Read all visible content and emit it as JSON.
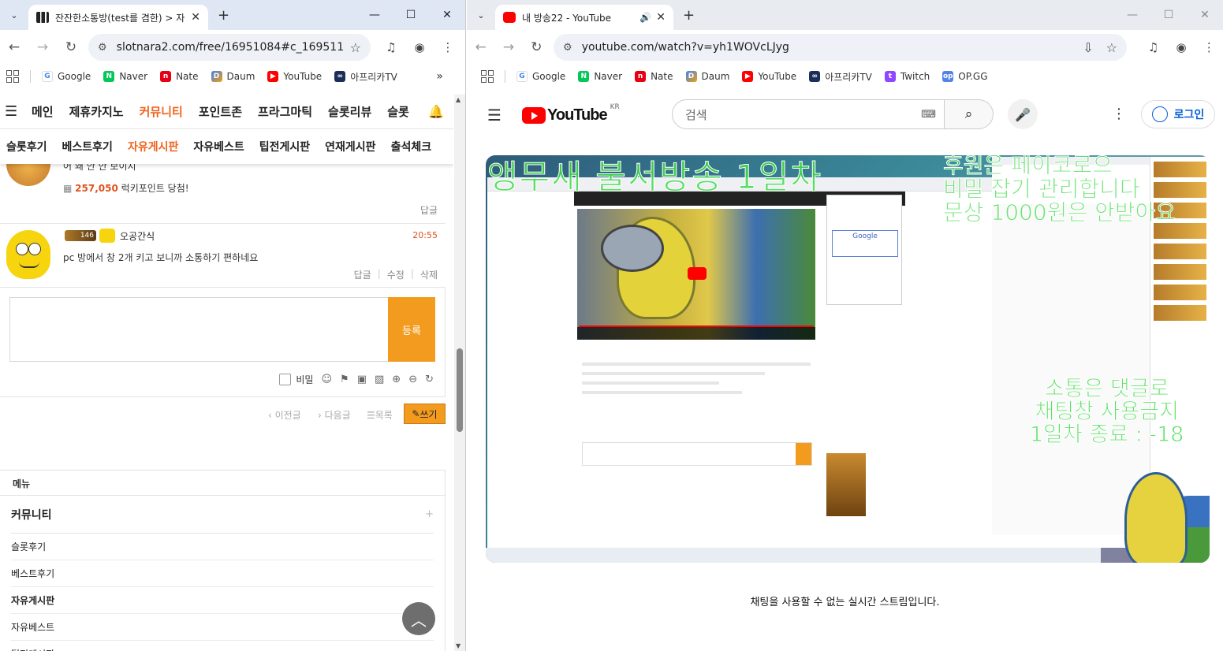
{
  "left": {
    "tab": {
      "title": "잔잔한소통방(test를 겸한) > 자"
    },
    "url": "slotnara2.com/free/16951084#c_16951133",
    "bookmarks": [
      "Google",
      "Naver",
      "Nate",
      "Daum",
      "YouTube",
      "아프리카TV"
    ],
    "gnb": [
      "메인",
      "제휴카지노",
      "커뮤니티",
      "포인트존",
      "프라그마틱",
      "슬롯리뷰",
      "슬롯"
    ],
    "subnav": [
      "슬롯후기",
      "베스트후기",
      "자유게시판",
      "자유베스트",
      "팁전게시판",
      "연재게시판",
      "출석체크"
    ],
    "comment1": {
      "clip": "어 왜 안 안 보이지",
      "points": "257,050",
      "lucky_suffix": "럭키포인트 당첨!",
      "reply": "답글"
    },
    "comment2": {
      "level": "146",
      "nick": "오공간식",
      "time": "20:55",
      "body": "pc 방에서 창 2개 키고 보니까 소통하기 편하네요",
      "reply": "답글",
      "edit": "수정",
      "delete": "삭제"
    },
    "write": {
      "submit": "등록",
      "secret": "비밀"
    },
    "pager": {
      "prev": "이전글",
      "next": "다음글",
      "list": "목록",
      "write": "쓰기"
    },
    "menu": {
      "header": "메뉴",
      "category": "커뮤니티",
      "items": [
        "슬롯후기",
        "베스트후기",
        "자유게시판",
        "자유베스트",
        "팁전게시판"
      ]
    }
  },
  "right": {
    "tab": {
      "title": "내 방송22 - YouTube"
    },
    "url": "youtube.com/watch?v=yh1WOVcLJyg",
    "bookmarks": [
      "Google",
      "Naver",
      "Nate",
      "Daum",
      "YouTube",
      "아프리카TV",
      "Twitch",
      "OP.GG"
    ],
    "yt": {
      "logo": "YouTube",
      "region": "KR",
      "search_placeholder": "검색",
      "login": "로그인"
    },
    "overlay": {
      "title": "앵무새 불서방송 1일차",
      "notice_lines": [
        "후원은 페이코로으",
        "비밀 잡기 관리합니다",
        "문상 1000원은 안받아요"
      ],
      "chat_lines": [
        "소통은 댓글로",
        "채팅창 사용금지",
        "1일차 종료 : -18"
      ]
    },
    "chat_unavailable": "채팅을 사용할 수 없는 실시간 스트림입니다."
  },
  "colors": {
    "accent": "#f0641e",
    "orange_button": "#f39b1f",
    "youtube_red": "#ff0000",
    "overlay_green": "#3cdc46"
  }
}
